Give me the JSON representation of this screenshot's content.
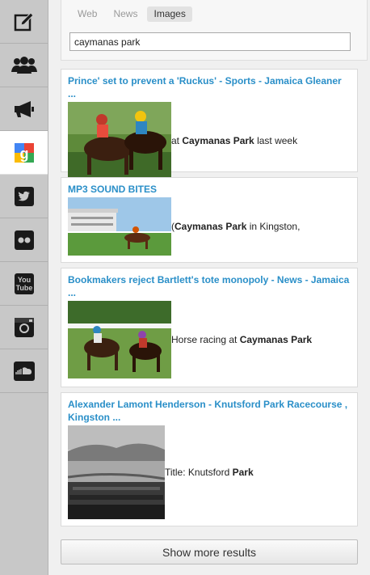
{
  "sidebar": {
    "items": [
      {
        "name": "compose",
        "icon": "pencil-edit-icon"
      },
      {
        "name": "people",
        "icon": "group-icon"
      },
      {
        "name": "announce",
        "icon": "megaphone-icon"
      },
      {
        "name": "google",
        "icon": "google-icon",
        "active": true
      },
      {
        "name": "twitter",
        "icon": "twitter-icon"
      },
      {
        "name": "flickr",
        "icon": "flickr-icon"
      },
      {
        "name": "youtube",
        "icon": "youtube-icon"
      },
      {
        "name": "instagram",
        "icon": "instagram-icon"
      },
      {
        "name": "soundcloud",
        "icon": "soundcloud-icon"
      }
    ],
    "youtube_label_top": "You",
    "youtube_label_bottom": "Tube"
  },
  "search": {
    "tabs": [
      {
        "label": "Web"
      },
      {
        "label": "News"
      },
      {
        "label": "Images"
      }
    ],
    "active_tab": "Images",
    "query": "caymanas park"
  },
  "results": [
    {
      "title": "Prince' set to prevent a 'Ruckus' - Sports - Jamaica Gleaner ...",
      "snippet_pre": "at ",
      "snippet_bold": "Caymanas Park",
      "snippet_post": " last week"
    },
    {
      "title": "MP3 SOUND BITES",
      "snippet_pre": "(",
      "snippet_bold": "Caymanas Park",
      "snippet_post": " in Kingston,"
    },
    {
      "title": "Bookmakers reject Bartlett's tote monopoly - News - Jamaica ...",
      "snippet_pre": "Horse racing at ",
      "snippet_bold": "Caymanas Park",
      "snippet_post": ""
    },
    {
      "title": "Alexander Lamont Henderson - Knutsford Park Racecourse , Kingston ...",
      "snippet_pre": "Title: Knutsford ",
      "snippet_bold": "Park",
      "snippet_post": ""
    }
  ],
  "show_more_label": "Show more results",
  "colors": {
    "link": "#2a8fc8",
    "sidebar": "#c8c8c8",
    "background": "#f0f0f0"
  }
}
